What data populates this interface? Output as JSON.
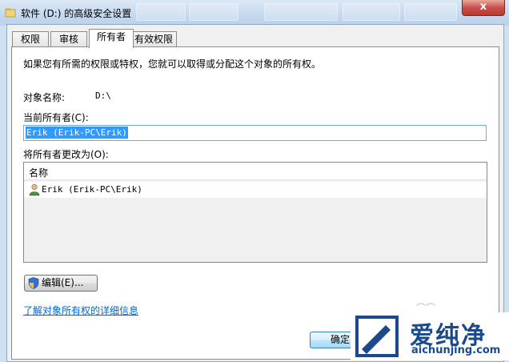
{
  "window": {
    "title": "软件 (D:) 的高级安全设置",
    "close_label": "x"
  },
  "tabs": [
    {
      "label": "权限",
      "active": false
    },
    {
      "label": "审核",
      "active": false
    },
    {
      "label": "所有者",
      "active": true
    },
    {
      "label": "有效权限",
      "active": false
    }
  ],
  "owner_tab": {
    "description": "如果您有所需的权限或特权，您就可以取得或分配这个对象的所有权。",
    "object_name_label": "对象名称:",
    "object_name_value": "D:\\",
    "current_owner_label": "当前所有者(C):",
    "current_owner_value": "Erik (Erik-PC\\Erik)",
    "change_owner_label": "将所有者更改为(O):",
    "list": {
      "column_header": "名称",
      "rows": [
        {
          "name": "Erik (Erik-PC\\Erik)",
          "icon": "user-icon"
        }
      ]
    },
    "edit_button_label": "编辑(E)...",
    "details_link": "了解对象所有权的详细信息"
  },
  "footer": {
    "ok_label": "确定"
  },
  "watermark": {
    "brand_cn": "爱纯净",
    "brand_en": "aichunjing.com"
  },
  "colors": {
    "link": "#0066cc",
    "selection": "#3399ff",
    "watermark": "#1a4a8a"
  }
}
